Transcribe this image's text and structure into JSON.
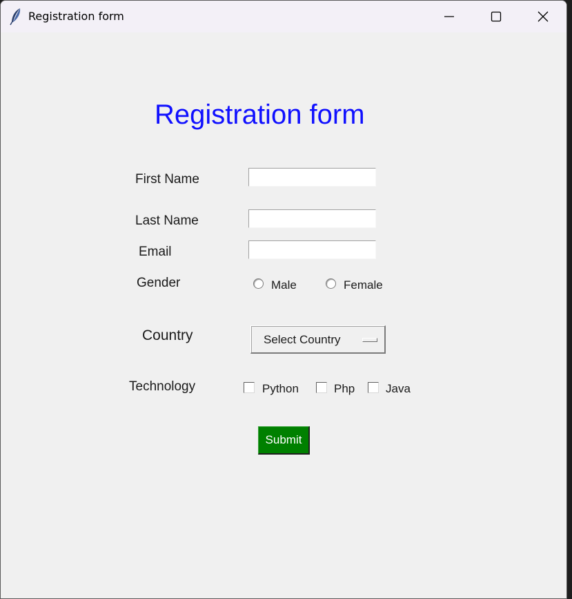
{
  "window": {
    "title": "Registration form"
  },
  "form": {
    "heading": "Registration form",
    "first_name_label": "First Name",
    "first_name_value": "",
    "last_name_label": "Last Name",
    "last_name_value": "",
    "email_label": "Email",
    "email_value": "",
    "gender_label": "Gender",
    "gender_options": [
      "Male",
      "Female"
    ],
    "country_label": "Country",
    "country_selected": "Select Country",
    "technology_label": "Technology",
    "technology_options": [
      "Python",
      "Php",
      "Java"
    ],
    "submit_label": "Submit"
  },
  "colors": {
    "heading": "#1010ff",
    "submit_bg": "#008000",
    "submit_text": "#ffffff",
    "window_bg": "#f0f0f0"
  },
  "icons": {
    "app": "feather-icon",
    "minimize": "minimize-icon",
    "maximize": "maximize-icon",
    "close": "close-icon"
  }
}
